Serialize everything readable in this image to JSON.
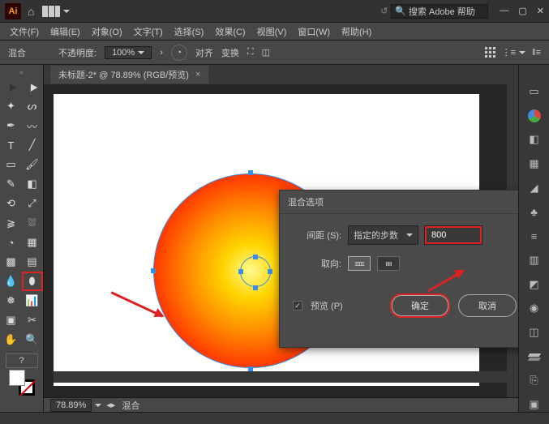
{
  "app": {
    "name": "Ai"
  },
  "search": {
    "placeholder": "搜索 Adobe 帮助",
    "icon_label": "🔍"
  },
  "menu": {
    "file": "文件(F)",
    "edit": "编辑(E)",
    "object": "对象(O)",
    "type": "文字(T)",
    "select": "选择(S)",
    "effect": "效果(C)",
    "view": "视图(V)",
    "window": "窗口(W)",
    "help": "帮助(H)"
  },
  "options": {
    "blend": "混合",
    "opacity_label": "不透明度:",
    "opacity_value": "100%",
    "align": "对齐",
    "transform": "变换"
  },
  "tab": {
    "title": "未标题-2* @ 78.89% (RGB/预览)",
    "close": "×"
  },
  "dialog": {
    "title": "混合选项",
    "spacing_label": "间距 (S):",
    "spacing_type": "指定的步数",
    "spacing_value": "800",
    "orientation_label": "取向:",
    "preview": "预览 (P)",
    "ok": "确定",
    "cancel": "取消"
  },
  "status": {
    "zoom": "78.89%",
    "blend": "混合"
  }
}
